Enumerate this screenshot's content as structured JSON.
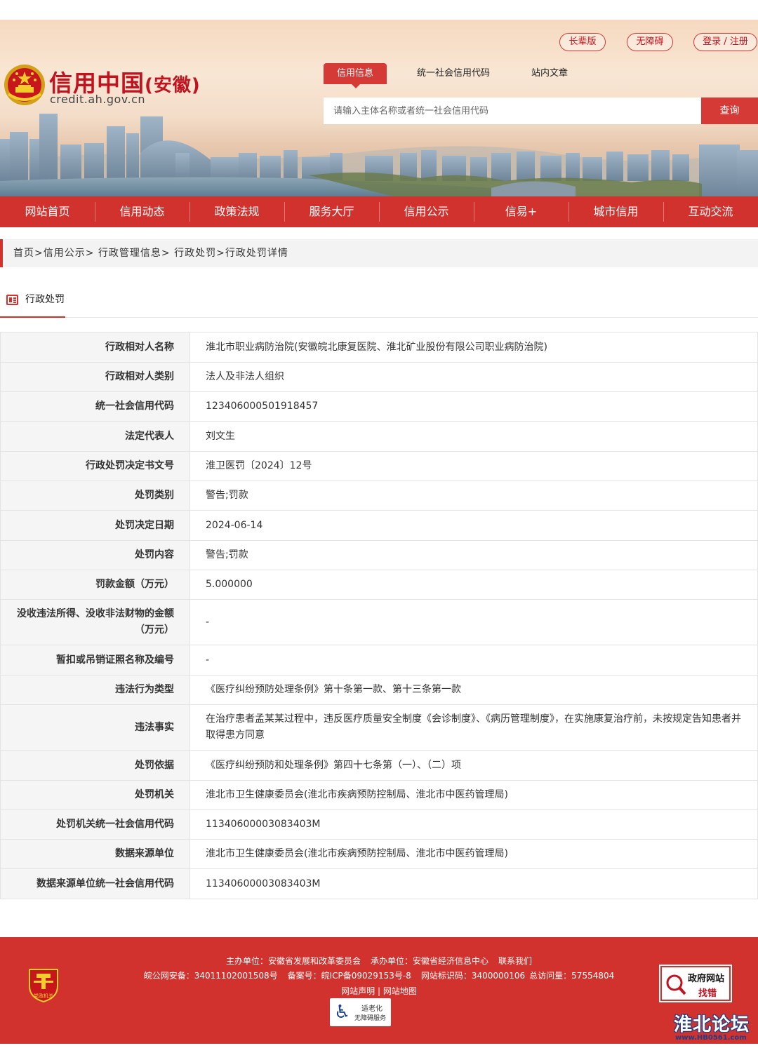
{
  "header": {
    "logo_title": "信用中国",
    "logo_region": "安徽",
    "logo_paren_open": "(",
    "logo_paren_close": ")",
    "logo_domain": "credit.ah.gov.cn",
    "top_buttons": [
      "长辈版",
      "无障碍",
      "登录 / 注册"
    ],
    "search_tabs": [
      "信用信息",
      "统一社会信用代码",
      "站内文章"
    ],
    "search_placeholder": "请输入主体名称或者统一社会信用代码",
    "search_button": "查询"
  },
  "nav": [
    "网站首页",
    "信用动态",
    "政策法规",
    "服务大厅",
    "信用公示",
    "信易+",
    "城市信用",
    "互动交流"
  ],
  "breadcrumb": "首页>信用公示> 行政管理信息> 行政处罚>行政处罚详情",
  "section_title": "行政处罚",
  "rows": [
    {
      "k": "行政相对人名称",
      "v": "淮北市职业病防治院(安徽皖北康复医院、淮北矿业股份有限公司职业病防治院)"
    },
    {
      "k": "行政相对人类别",
      "v": "法人及非法人组织"
    },
    {
      "k": "统一社会信用代码",
      "v": "123406000501918457"
    },
    {
      "k": "法定代表人",
      "v": "刘文生"
    },
    {
      "k": "行政处罚决定书文号",
      "v": "淮卫医罚〔2024〕12号"
    },
    {
      "k": "处罚类别",
      "v": "警告;罚款"
    },
    {
      "k": "处罚决定日期",
      "v": "2024-06-14"
    },
    {
      "k": "处罚内容",
      "v": "警告;罚款"
    },
    {
      "k": "罚款金额（万元）",
      "v": "5.000000"
    },
    {
      "k": "没收违法所得、没收非法财物的金额（万元）",
      "v": "-"
    },
    {
      "k": "暂扣或吊销证照名称及编号",
      "v": "-"
    },
    {
      "k": "违法行为类型",
      "v": "《医疗纠纷预防处理条例》第十条第一款、第十三条第一款"
    },
    {
      "k": "违法事实",
      "v": "在治疗患者孟某某过程中，违反医疗质量安全制度《会诊制度》、《病历管理制度》，在实施康复治疗前，未按规定告知患者并取得患方同意"
    },
    {
      "k": "处罚依据",
      "v": "《医疗纠纷预防和处理条例》第四十七条第（一）、（二）项"
    },
    {
      "k": "处罚机关",
      "v": "淮北市卫生健康委员会(淮北市疾病预防控制局、淮北市中医药管理局)"
    },
    {
      "k": "处罚机关统一社会信用代码",
      "v": "11340600003083403M"
    },
    {
      "k": "数据来源单位",
      "v": "淮北市卫生健康委员会(淮北市疾病预防控制局、淮北市中医药管理局)"
    },
    {
      "k": "数据来源单位统一社会信用代码",
      "v": "11340600003083403M"
    }
  ],
  "footer": {
    "host": "主办单位：安徽省发展和改革委员会",
    "undertake": "承办单位：安徽省经济信息中心",
    "contact": "联系我们",
    "police_record": "皖公网安备：34011102001508号",
    "icp": "备案号：皖ICP备09029153号-8",
    "site_id": "网站标识码：3400000106",
    "visits": "总访问量：57554804",
    "statement": "网站声明",
    "divider": "|",
    "sitemap": "网站地图",
    "party_badge": "党政机关",
    "elder_line1": "适老化",
    "elder_line2": "无障碍服务",
    "gov_line1": "政府网站",
    "gov_line2": "找错"
  },
  "watermark": {
    "title": "淮北论坛",
    "url": "www.HB0561.com"
  },
  "colors": {
    "brand_red": "#d2322e",
    "logo_red": "#c1121f"
  }
}
